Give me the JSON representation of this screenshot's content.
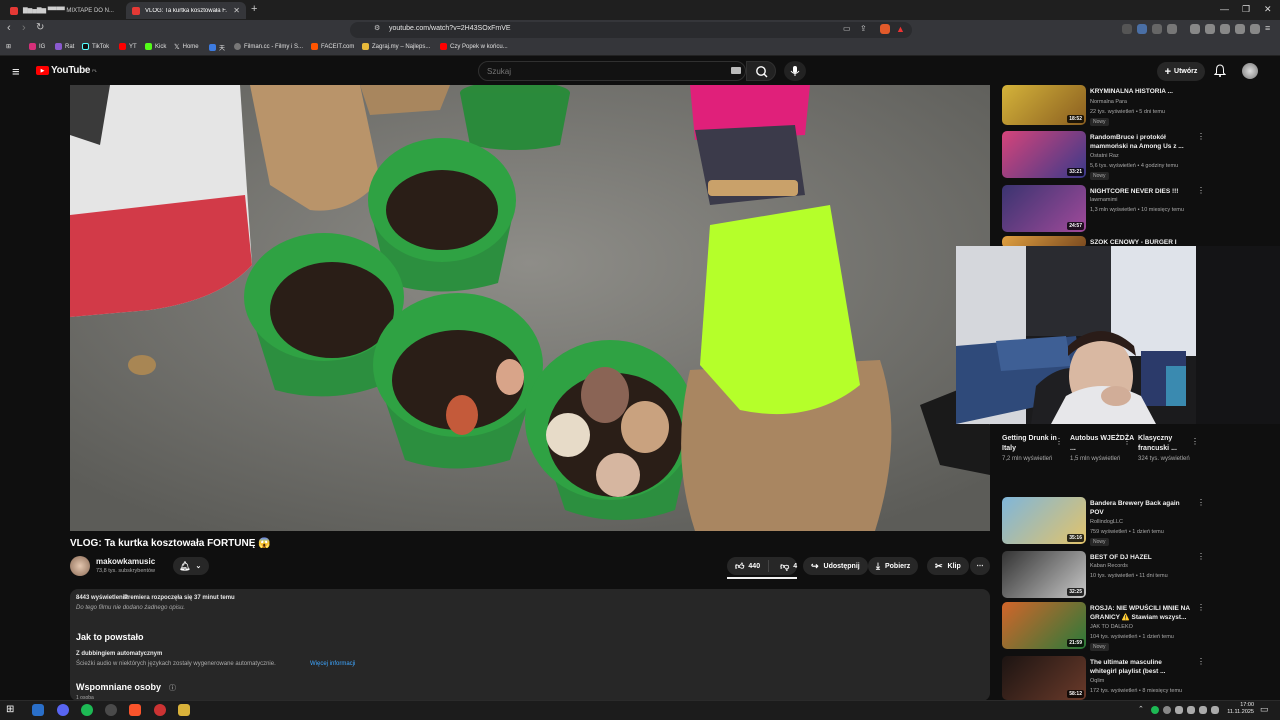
{
  "browser": {
    "tabs": [
      {
        "title": "▇▆▅▇▆ ▀▀▀▀ MIXTAPE DO N..."
      },
      {
        "title": "VLOG: Ta kurtka kosztowała F..."
      }
    ],
    "url": "youtube.com/watch?v=2H43SOxFmVE",
    "bookmarks": [
      {
        "label": "IG"
      },
      {
        "label": "Rat"
      },
      {
        "label": "TikTok"
      },
      {
        "label": "YT"
      },
      {
        "label": "Kick"
      },
      {
        "label": "Home"
      },
      {
        "label": "天"
      },
      {
        "label": "Filman.cc - Filmy i S..."
      },
      {
        "label": "FACEIT.com"
      },
      {
        "label": "Zagraj.my – Najleps..."
      },
      {
        "label": "Czy Popek w końcu..."
      }
    ]
  },
  "yt": {
    "logo": "YouTube",
    "region": "PL",
    "search_placeholder": "Szukaj",
    "create": "Utwórz"
  },
  "video": {
    "title": "VLOG: Ta kurtka kosztowała FORTUNĘ 😱",
    "channel": "makowkamusic",
    "subscribers": "73,8 tys. subskrybentów",
    "likes": "440",
    "dislikes": "4",
    "share": "Udostępnij",
    "download": "Pobierz",
    "clip": "Klip"
  },
  "description": {
    "views": "8443 wyświetlenia",
    "premiere": "Premiera rozpoczęła się 37 minut temu",
    "no_desc": "Do tego filmu nie dodano żadnego opisu.",
    "section_title": "Jak to powstało",
    "dub_title": "Z dubbingiem automatycznym",
    "dub_text": "Ścieżki audio w niektórych językach zostały wygenerowane automatycznie.",
    "more_info": "Więcej informacji",
    "mentioned": "Wspomniane osoby",
    "mentioned_count": "1 osoba"
  },
  "sidebar": {
    "items": [
      {
        "title": "KRYMINALNA HISTORIA ...",
        "channel": "Normalna Para",
        "meta": "22 tys. wyświetleń • 5 dni temu",
        "badge": "Nowy",
        "duration": "18:52",
        "thumb_color": "#b79a2a"
      },
      {
        "title": "RandomBruce i protokół mammoński na Among Us z ...",
        "channel": "Ostatni Raz",
        "meta": "5,6 tys. wyświetleń • 4 godziny temu",
        "badge": "Nowy",
        "duration": "33:21",
        "thumb_color": "#a8364a"
      },
      {
        "title": "NIGHTCORE NEVER DIES !!!",
        "channel": "lawmamimi",
        "meta": "1,3 mln wyświetleń • 10 miesięcy temu",
        "badge": "",
        "duration": "24:57",
        "thumb_color": "#4a3d7a"
      },
      {
        "title": "SZOK CENOWY - BURGER I",
        "channel": "",
        "meta": "",
        "badge": "",
        "duration": "",
        "thumb_color": "#c98a2a"
      }
    ],
    "shorts": [
      {
        "title": "Getting Drunk in Italy",
        "views": "7,2 mln wyświetleń"
      },
      {
        "title": "Autobus WJEŻDŻA ...",
        "views": "1,5 mln wyświetleń"
      },
      {
        "title": "Klasyczny francuski ...",
        "views": "324 tys. wyświetleń"
      }
    ],
    "items2": [
      {
        "title": "Bandera Brewery Back again POV",
        "channel": "RollindogLLC",
        "meta": "759 wyświetleń • 1 dzień temu",
        "badge": "Nowy",
        "duration": "35:16",
        "thumb_color": "#5a8fb0"
      },
      {
        "title": "BEST OF DJ HAZEL",
        "channel": "Kaban Records",
        "meta": "10 tys. wyświetleń • 11 dni temu",
        "badge": "",
        "duration": "32:25",
        "thumb_color": "#8a8a8a"
      },
      {
        "title": "ROSJA: NIE WPUŚCILI MNIE NA GRANICY ⚠️ Stawiam wszyst...",
        "channel": "JAK TO DALEKO",
        "meta": "104 tys. wyświetleń • 1 dzień temu",
        "badge": "Nowy",
        "duration": "21:59",
        "thumb_color": "#3a7a3a"
      },
      {
        "title": "The ultimate masculine whitegirl playlist (best ...",
        "channel": "Oqlim",
        "meta": "172 tys. wyświetleń • 8 miesięcy temu",
        "badge": "",
        "duration": "58:12",
        "thumb_color": "#3a2420"
      }
    ]
  },
  "taskbar": {
    "time": "17:00",
    "date": "11.11.2025"
  }
}
